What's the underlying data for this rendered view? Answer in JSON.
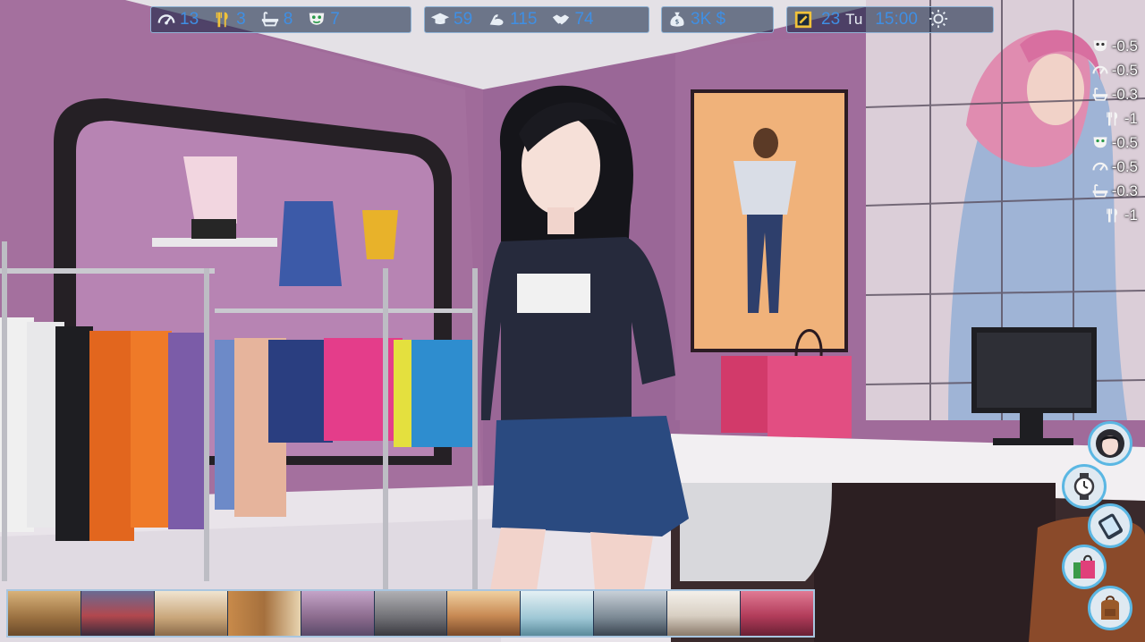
{
  "hud_left": {
    "stats": [
      {
        "icon": "speedometer-icon",
        "value": "13"
      },
      {
        "icon": "fork-knife-icon",
        "value": "3"
      },
      {
        "icon": "bathtub-icon",
        "value": "8"
      },
      {
        "icon": "mood-mask-icon",
        "value": "7"
      }
    ]
  },
  "hud_mid": {
    "stats": [
      {
        "icon": "graduation-cap-icon",
        "value": "59"
      },
      {
        "icon": "muscle-arm-icon",
        "value": "115"
      },
      {
        "icon": "handshake-icon",
        "value": "74"
      }
    ]
  },
  "hud_money": {
    "icon": "money-bag-icon",
    "value": "3K $"
  },
  "hud_time": {
    "icon": "notebook-icon",
    "day": "23",
    "weekday": "Tu",
    "time": "15:00",
    "weather_icon": "sun-icon"
  },
  "effects": [
    {
      "icon": "mood-mask-icon",
      "value": "-0.5"
    },
    {
      "icon": "speedometer-icon",
      "value": "-0.5"
    },
    {
      "icon": "bathtub-icon",
      "value": "-0.3"
    },
    {
      "icon": "fork-knife-icon",
      "value": "-1"
    },
    {
      "icon": "mood-mask-icon",
      "value": "-0.5"
    },
    {
      "icon": "speedometer-icon",
      "value": "-0.5"
    },
    {
      "icon": "bathtub-icon",
      "value": "-0.3"
    },
    {
      "icon": "fork-knife-icon",
      "value": "-1"
    }
  ],
  "side_menu": [
    {
      "name": "character-portrait-button",
      "icon": "portrait-icon"
    },
    {
      "name": "wait-watch-button",
      "icon": "wristwatch-icon"
    },
    {
      "name": "phone-button",
      "icon": "smartphone-icon"
    },
    {
      "name": "shop-button",
      "icon": "shopping-bag-icon"
    },
    {
      "name": "inventory-button",
      "icon": "backpack-icon"
    }
  ],
  "locations": [
    {
      "name": "location-mall-hall",
      "color": "#b08a55"
    },
    {
      "name": "location-arcade",
      "color": "#b2484e"
    },
    {
      "name": "location-bakery",
      "color": "#c9a67a"
    },
    {
      "name": "location-bookstore",
      "color": "#a5703d"
    },
    {
      "name": "location-boutique",
      "color": "#8a6a8c"
    },
    {
      "name": "location-gym",
      "color": "#8f8f8f"
    },
    {
      "name": "location-restaurant",
      "color": "#c88a54"
    },
    {
      "name": "location-lab",
      "color": "#9fc8d6"
    },
    {
      "name": "location-office",
      "color": "#7a8893"
    },
    {
      "name": "location-kitchen",
      "color": "#d8cfc3"
    },
    {
      "name": "location-lingerie-store",
      "color": "#b33d5b"
    }
  ]
}
